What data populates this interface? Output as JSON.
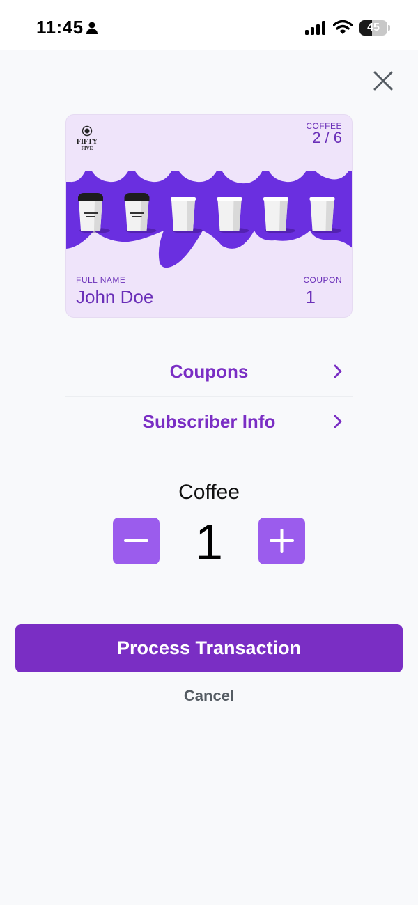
{
  "status_bar": {
    "time": "11:45",
    "battery_percent": 45,
    "battery_text": "45",
    "icons": [
      "person-icon",
      "signal-icon",
      "wifi-icon",
      "battery-icon"
    ]
  },
  "card": {
    "brand_line1": "FIFTY",
    "brand_line2": "FIVE",
    "product_label": "COFFEE",
    "progress_text": "2 / 6",
    "stamps_filled": 2,
    "stamps_total": 6,
    "name_label": "FULL NAME",
    "name_value": "John Doe",
    "coupon_label": "COUPON",
    "coupon_value": "1"
  },
  "links": {
    "coupons": "Coupons",
    "subscriber_info": "Subscriber Info"
  },
  "stepper": {
    "label": "Coffee",
    "quantity": "1"
  },
  "actions": {
    "process": "Process Transaction",
    "cancel": "Cancel"
  },
  "colors": {
    "brand_purple": "#7a2ec4",
    "stepper_purple": "#9b5ced",
    "card_art_purple": "#6a2fe0",
    "card_bg": "#efe4fa"
  }
}
